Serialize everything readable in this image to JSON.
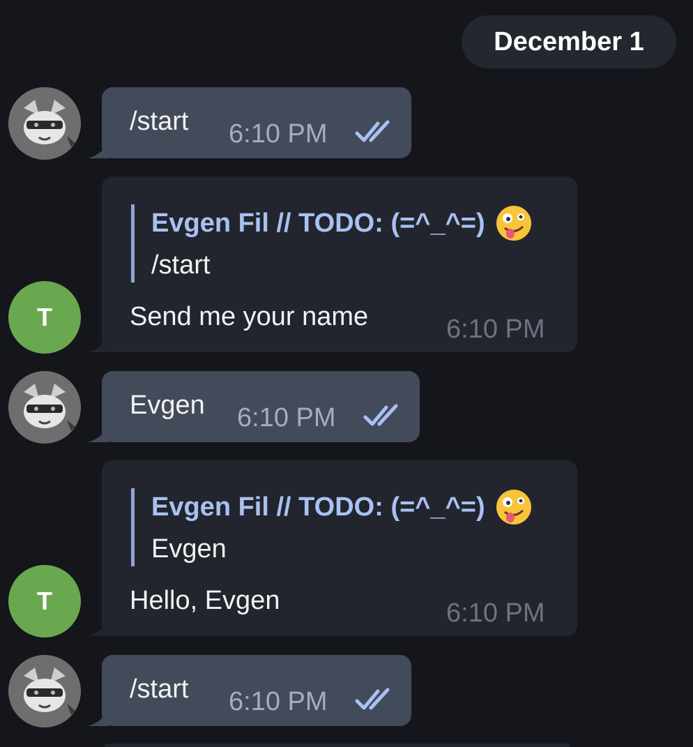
{
  "chat": {
    "date_label": "December 1",
    "messages": [
      {
        "kind": "outgoing",
        "text": "/start",
        "time": "6:10 PM",
        "status_icon": "double-check-icon"
      },
      {
        "kind": "incoming",
        "avatar_letter": "T",
        "reply": {
          "author": "Evgen Fil // TODO: (=^_^=)",
          "emoji": "zany-face-emoji",
          "text": "/start"
        },
        "text": "Send me your name",
        "time": "6:10 PM"
      },
      {
        "kind": "outgoing",
        "text": "Evgen",
        "time": "6:10 PM",
        "status_icon": "double-check-icon"
      },
      {
        "kind": "incoming",
        "avatar_letter": "T",
        "reply": {
          "author": "Evgen Fil // TODO: (=^_^=)",
          "emoji": "zany-face-emoji",
          "text": "Evgen"
        },
        "text": "Hello, Evgen",
        "time": "6:10 PM"
      },
      {
        "kind": "outgoing",
        "text": "/start",
        "time": "6:10 PM",
        "status_icon": "double-check-icon"
      }
    ]
  },
  "colors": {
    "background": "#14161b",
    "outgoing_bubble": "#434b5a",
    "incoming_bubble": "#22252d",
    "reply_accent": "#a9c1f2",
    "bot_avatar": "#6aa84f"
  }
}
